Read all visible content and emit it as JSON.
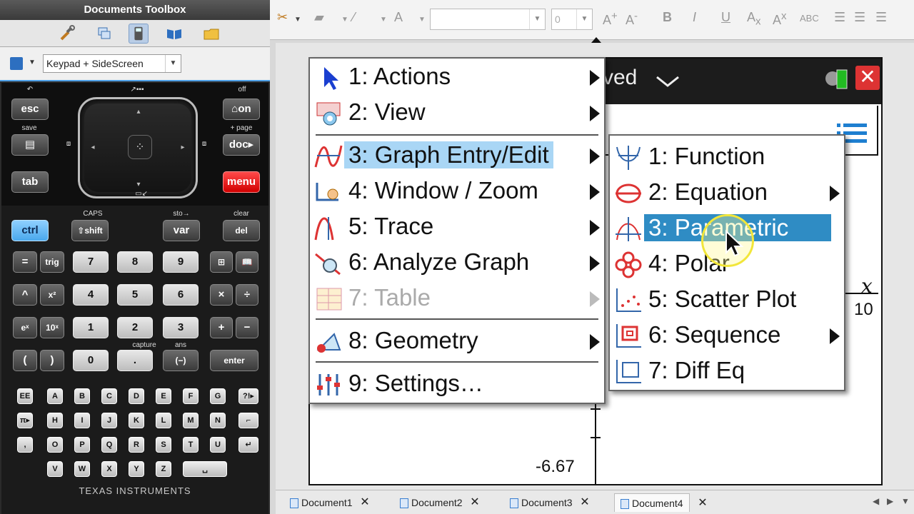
{
  "toolbox": {
    "title": "Documents Toolbox",
    "keypad_select": "Keypad + SideScreen"
  },
  "calculator": {
    "top_labels": {
      "off": "off",
      "save": "save",
      "page": "+ page",
      "caps": "CAPS",
      "sto": "sto→",
      "clear": "clear",
      "capture": "capture",
      "ans": "ans"
    },
    "keys": {
      "esc": "esc",
      "on": "⌂on",
      "doc": "doc▸",
      "tab": "tab",
      "menu": "menu",
      "ctrl": "ctrl",
      "shift": "⇧shift",
      "var": "var",
      "del": "del",
      "eq": "=",
      "trig": "trig",
      "k7": "7",
      "k8": "8",
      "k9": "9",
      "caret": "^",
      "x2": "x²",
      "k4": "4",
      "k5": "5",
      "k6": "6",
      "times": "×",
      "div": "÷",
      "ex": "eˣ",
      "tenx": "10ˣ",
      "k1": "1",
      "k2": "2",
      "k3": "3",
      "plus": "+",
      "minus": "−",
      "lparen": "(",
      "rparen": ")",
      "k0": "0",
      "dot": ".",
      "neg": "(−)",
      "enter": "enter"
    },
    "alpha_rows": [
      [
        "EE",
        "A",
        "B",
        "C",
        "D",
        "E",
        "F",
        "G",
        "?!▸"
      ],
      [
        "π▸",
        "H",
        "I",
        "J",
        "K",
        "L",
        "M",
        "N",
        "⌐"
      ],
      [
        ",",
        "O",
        "P",
        "Q",
        "R",
        "S",
        "T",
        "U",
        "↵"
      ],
      [
        "V",
        "W",
        "X",
        "Y",
        "Z",
        "␣"
      ]
    ],
    "brand": "TEXAS INSTRUMENTS"
  },
  "toolbar": {
    "size_value": "0",
    "font_value": ""
  },
  "document": {
    "header_text": "ved",
    "y_value_label": "-6.67",
    "x_value_label": "10",
    "x_axis_var": "x"
  },
  "main_menu": {
    "items": [
      {
        "label": "1: Actions",
        "icon": "cursor-arrow-icon",
        "submenu": true
      },
      {
        "label": "2: View",
        "icon": "camera-view-icon",
        "submenu": true
      },
      {
        "label": "3: Graph Entry/Edit",
        "icon": "graph-entry-icon",
        "submenu": true,
        "highlighted": true
      },
      {
        "label": "4: Window / Zoom",
        "icon": "window-zoom-icon",
        "submenu": true
      },
      {
        "label": "5: Trace",
        "icon": "trace-icon",
        "submenu": true
      },
      {
        "label": "6: Analyze Graph",
        "icon": "analyze-graph-icon",
        "submenu": true
      },
      {
        "label": "7: Table",
        "icon": "table-icon",
        "submenu": true,
        "disabled": true
      },
      {
        "label": "8: Geometry",
        "icon": "geometry-icon",
        "submenu": true
      },
      {
        "label": "9: Settings…",
        "icon": "settings-sliders-icon",
        "submenu": false
      }
    ]
  },
  "sub_menu": {
    "items": [
      {
        "label": "1: Function",
        "icon": "function-icon",
        "submenu": false
      },
      {
        "label": "2: Equation",
        "icon": "equation-icon",
        "submenu": true
      },
      {
        "label": "3: Parametric",
        "icon": "parametric-icon",
        "submenu": false,
        "selected": true
      },
      {
        "label": "4: Polar",
        "icon": "polar-icon",
        "submenu": false
      },
      {
        "label": "5: Scatter Plot",
        "icon": "scatter-plot-icon",
        "submenu": false
      },
      {
        "label": "6: Sequence",
        "icon": "sequence-icon",
        "submenu": true
      },
      {
        "label": "7: Diff Eq",
        "icon": "diff-eq-icon",
        "submenu": false
      }
    ]
  },
  "tabs": [
    {
      "label": "Document1"
    },
    {
      "label": "Document2"
    },
    {
      "label": "Document3"
    },
    {
      "label": "Document4",
      "active": true
    }
  ],
  "colors": {
    "menu_highlight": "#a9d6f5",
    "submenu_selected": "#2f8cc4",
    "menu_key": "#e00000",
    "ctrl_key": "#4aa8ec"
  }
}
